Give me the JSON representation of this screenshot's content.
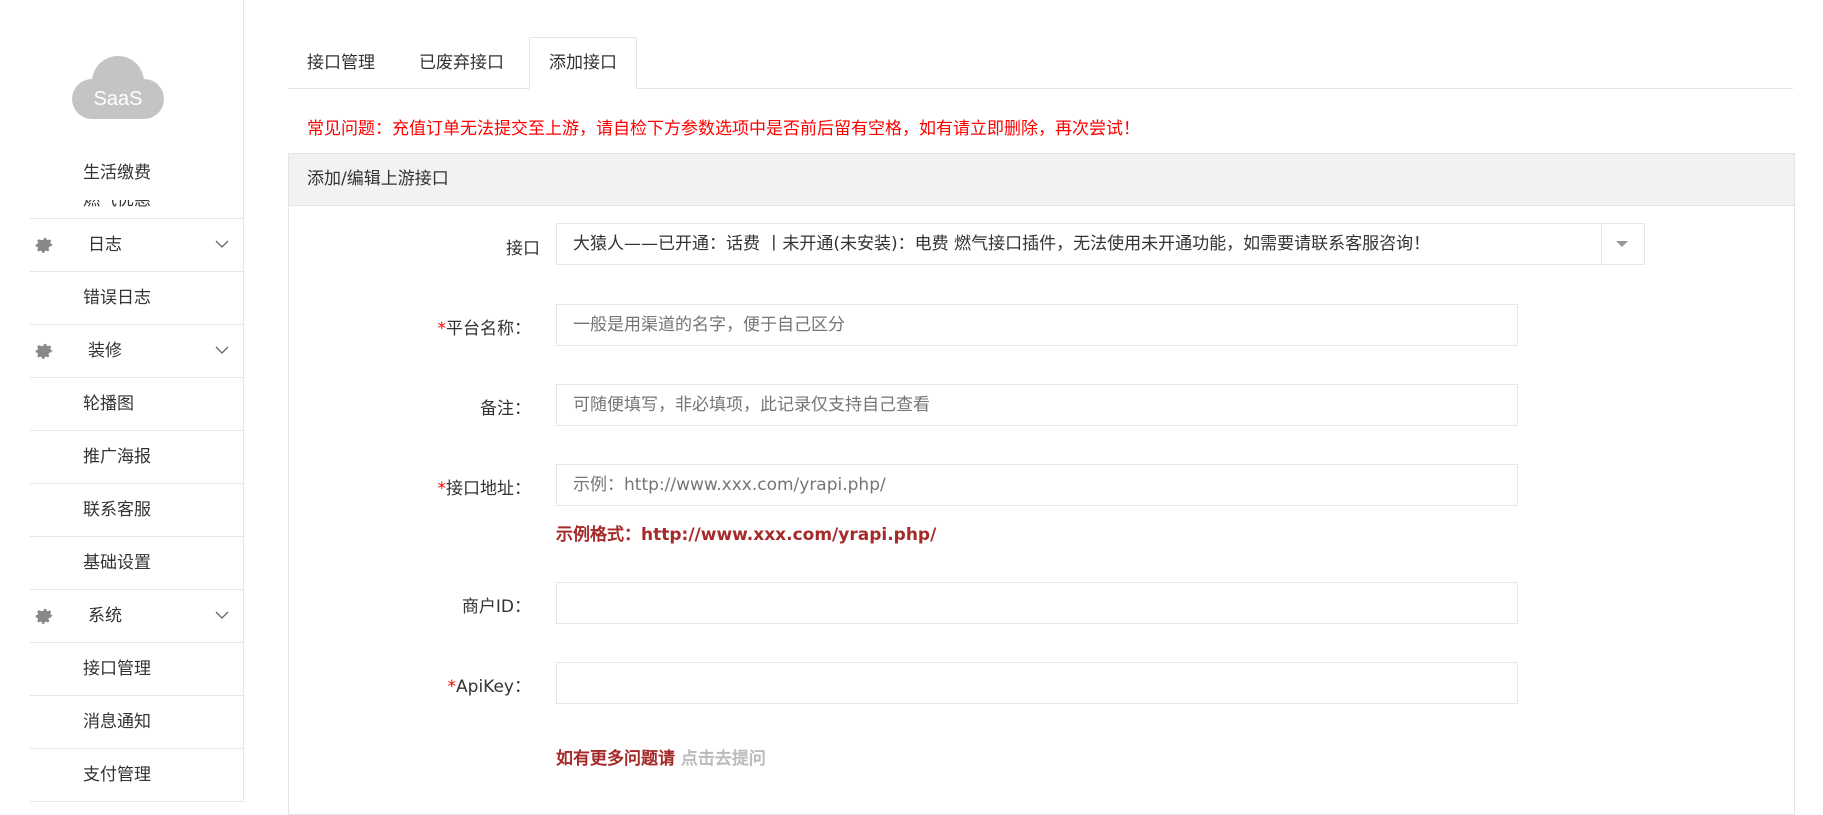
{
  "sidebar": {
    "logo_text": "SaaS",
    "top_item": "生活缴费",
    "clipped_item": "燃气优惠",
    "groups": [
      {
        "label": "日志",
        "items": [
          "错误日志"
        ]
      },
      {
        "label": "装修",
        "items": [
          "轮播图",
          "推广海报",
          "联系客服",
          "基础设置"
        ]
      },
      {
        "label": "系统",
        "items": [
          "接口管理",
          "消息通知",
          "支付管理"
        ]
      }
    ]
  },
  "tabs": [
    "接口管理",
    "已废弃接口",
    "添加接口"
  ],
  "active_tab": "添加接口",
  "notice": "常见问题：充值订单无法提交至上游，请自检下方参数选项中是否前后留有空格，如有请立即删除，再次尝试！",
  "panel": {
    "title": "添加/编辑上游接口",
    "interface": {
      "label": "接口",
      "value": "大猿人——已开通：话费 丨未开通(未安装)：电费 燃气接口插件，无法使用未开通功能，如需要请联系客服咨询！"
    },
    "platform_name": {
      "required": "*",
      "label": "平台名称：",
      "placeholder": "一般是用渠道的名字，便于自己区分",
      "value": ""
    },
    "remark": {
      "label": "备注：",
      "placeholder": "可随便填写，非必填项，此记录仅支持自己查看",
      "value": ""
    },
    "api_url": {
      "required": "*",
      "label": "接口地址：",
      "placeholder": "示例：http://www.xxx.com/yrapi.php/",
      "value": ""
    },
    "api_url_hint": "示例格式：http://www.xxx.com/yrapi.php/",
    "merchant_id": {
      "label": "商户ID：",
      "value": ""
    },
    "api_key": {
      "required": "*",
      "label": "ApiKey：",
      "value": ""
    },
    "help_text": "如有更多问题请",
    "help_link": "点击去提问"
  },
  "colors": {
    "notice": "#ff0000",
    "hint": "#a52a2a",
    "required": "#ff0000"
  }
}
